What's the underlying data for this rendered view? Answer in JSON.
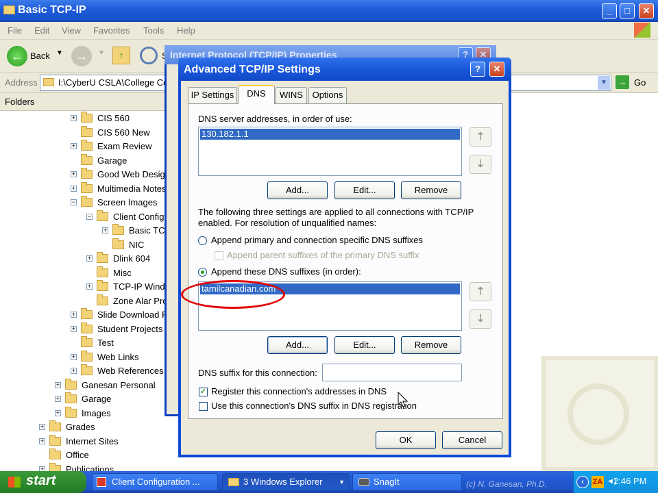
{
  "explorer": {
    "title": "Basic TCP-IP",
    "menu": [
      "File",
      "Edit",
      "View",
      "Favorites",
      "Tools",
      "Help"
    ],
    "toolbar": {
      "back_label": "Back",
      "search_partial": "S"
    },
    "address": {
      "label": "Address",
      "value": "I:\\CyberU CSLA\\College Co",
      "go_label": "Go"
    },
    "folders_label": "Folders",
    "tree": [
      {
        "label": "CIS 560",
        "expander": "+"
      },
      {
        "label": "CIS 560 New",
        "expander": ""
      },
      {
        "label": "Exam Review",
        "expander": "+"
      },
      {
        "label": "Garage",
        "expander": ""
      },
      {
        "label": "Good Web Design",
        "expander": "+"
      },
      {
        "label": "Multimedia Notes",
        "expander": "+"
      },
      {
        "label": "Screen Images",
        "expander": "−"
      },
      {
        "label": "Client Configu",
        "expander": "−"
      },
      {
        "label": "Basic TCP",
        "expander": "+"
      },
      {
        "label": "NIC",
        "expander": ""
      },
      {
        "label": "Dlink 604",
        "expander": "+"
      },
      {
        "label": "Misc",
        "expander": ""
      },
      {
        "label": "TCP-IP Windo",
        "expander": "+"
      },
      {
        "label": "Zone Alar Pro",
        "expander": ""
      },
      {
        "label": "Slide Download Pe",
        "expander": "+"
      },
      {
        "label": "Student Projects",
        "expander": "+"
      },
      {
        "label": "Test",
        "expander": ""
      },
      {
        "label": "Web Links",
        "expander": "+"
      },
      {
        "label": "Web References",
        "expander": "+"
      },
      {
        "label": "Ganesan Personal",
        "expander": "+"
      },
      {
        "label": "Garage",
        "expander": "+"
      },
      {
        "label": "Images",
        "expander": "+"
      },
      {
        "label": "Grades",
        "expander": "+"
      },
      {
        "label": "Internet Sites",
        "expander": "+"
      },
      {
        "label": "Office",
        "expander": ""
      },
      {
        "label": "Publications",
        "expander": "+"
      }
    ]
  },
  "bg_dialog": {
    "title": "Internet Protocol (TCP/IP) Properties"
  },
  "dialog": {
    "title": "Advanced TCP/IP Settings",
    "tabs": [
      "IP Settings",
      "DNS",
      "WINS",
      "Options"
    ],
    "active_tab": "DNS",
    "dns_servers_label": "DNS server addresses, in order of use:",
    "dns_servers": [
      "130.182.1.1"
    ],
    "add_label": "Add...",
    "edit_label": "Edit...",
    "remove_label": "Remove",
    "settings_desc_1": "The following three settings are applied to all connections with TCP/IP",
    "settings_desc_2": "enabled. For resolution of unqualified names:",
    "radio_primary": "Append primary and connection specific DNS suffixes",
    "check_parent": "Append parent suffixes of the primary DNS suffix",
    "radio_these": "Append these DNS suffixes (in order):",
    "suffixes": [
      "tamilcanadian.com"
    ],
    "suffix_conn_label": "DNS suffix for this connection:",
    "suffix_conn_value": "",
    "check_register": "Register this connection's addresses in DNS",
    "check_use_suffix": "Use this connection's DNS suffix in DNS registration",
    "ok_label": "OK",
    "cancel_label": "Cancel",
    "register_checked": true,
    "use_suffix_checked": false,
    "selected_radio": "these"
  },
  "taskbar": {
    "start_label": "start",
    "tasks": [
      "Client Configuration ...",
      "3 Windows Explorer",
      "SnagIt"
    ],
    "clock": "2:46 PM",
    "watermark": "(c) N. Ganesan, Ph.D."
  },
  "colors": {
    "accent": "#0b4ad8",
    "selection": "#316ac5",
    "annotation": "#e00000"
  }
}
